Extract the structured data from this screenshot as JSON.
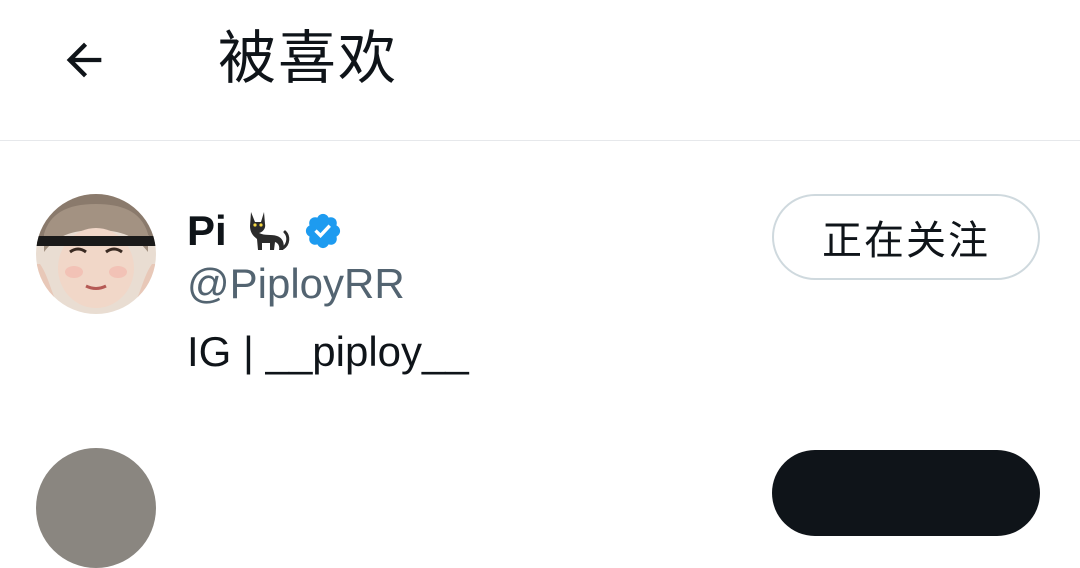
{
  "header": {
    "back_icon": "arrow-left-icon",
    "title": "被喜欢"
  },
  "users": [
    {
      "display_name": "Pi",
      "name_emoji": "black-cat-icon",
      "verified_icon": "verified-badge-icon",
      "verified_color": "#1d9bf0",
      "handle": "@PiployRR",
      "bio": "IG | __piploy__",
      "follow_label": "正在关注"
    }
  ],
  "colors": {
    "text_primary": "#0f1419",
    "text_secondary": "#536471",
    "divider": "#e6e8eb",
    "button_border": "#cfd9de"
  }
}
